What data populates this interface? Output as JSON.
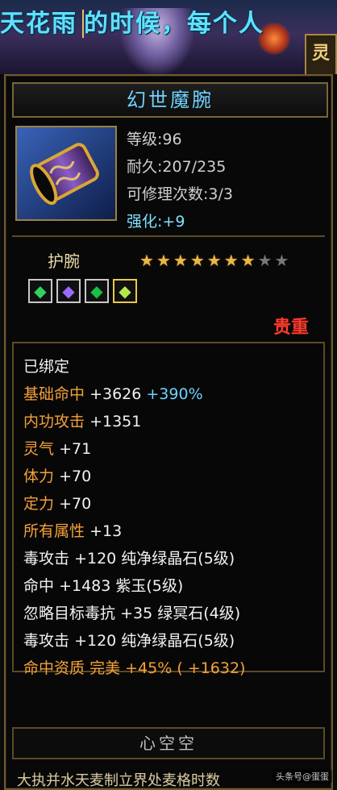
{
  "banner": {
    "lead": "天花雨",
    "text": "的时候，每个人",
    "side_char": "灵"
  },
  "item": {
    "name": "幻世魔腕",
    "stats": [
      {
        "key": "等级",
        "sep": ":",
        "value": "96"
      },
      {
        "key": "耐久",
        "sep": ":",
        "value": "207/235"
      },
      {
        "key": "可修理次数",
        "sep": ":",
        "value": "3/3"
      },
      {
        "key": "强化",
        "sep": ":",
        "value": "+9"
      }
    ],
    "type": "护腕",
    "stars_total": 9,
    "stars_filled": 7,
    "gems": [
      {
        "icon": "green-gem-icon",
        "color": "#2fd35a"
      },
      {
        "icon": "purple-gem-icon",
        "color": "#9b6bff"
      },
      {
        "icon": "green-leaf-gem-icon",
        "color": "#18c043"
      },
      {
        "icon": "yellow-green-gem-icon",
        "color": "#b7e84a"
      }
    ],
    "rarity": "贵重",
    "rarity_color": "#ff3a2a"
  },
  "attributes": {
    "bound": "已绑定",
    "lines": [
      {
        "label": "基础命中",
        "value": "+3626",
        "extra": "+390%"
      },
      {
        "label": "内功攻击",
        "value": "+1351"
      },
      {
        "label": "灵气",
        "value": "+71"
      },
      {
        "label": "体力",
        "value": "+70"
      },
      {
        "label": "定力",
        "value": "+70"
      },
      {
        "label": "所有属性",
        "value": "+13"
      },
      {
        "label": "毒攻击",
        "value": "+120",
        "source": "纯净绿晶石(5级)"
      },
      {
        "label": "命中",
        "value": "+1483",
        "source": "紫玉(5级)"
      },
      {
        "label": "忽略目标毒抗",
        "value": "+35",
        "source": "绿冥石(4级)"
      },
      {
        "label": "毒攻击",
        "value": "+120",
        "source": "纯净绿晶石(5级)"
      },
      {
        "label": "命中资质",
        "value": "完美",
        "extra": "+45%",
        "extra2": "( +1632)"
      }
    ]
  },
  "footer": {
    "section_title": "心空空",
    "partial_text": "大执并水天麦制立界处麦格时数",
    "watermark": "头条号@蛋蛋"
  },
  "colors": {
    "frame": "#6e5a30",
    "title": "#6fd3ff",
    "orange": "#f5a13a",
    "white": "#f2f2f2"
  }
}
